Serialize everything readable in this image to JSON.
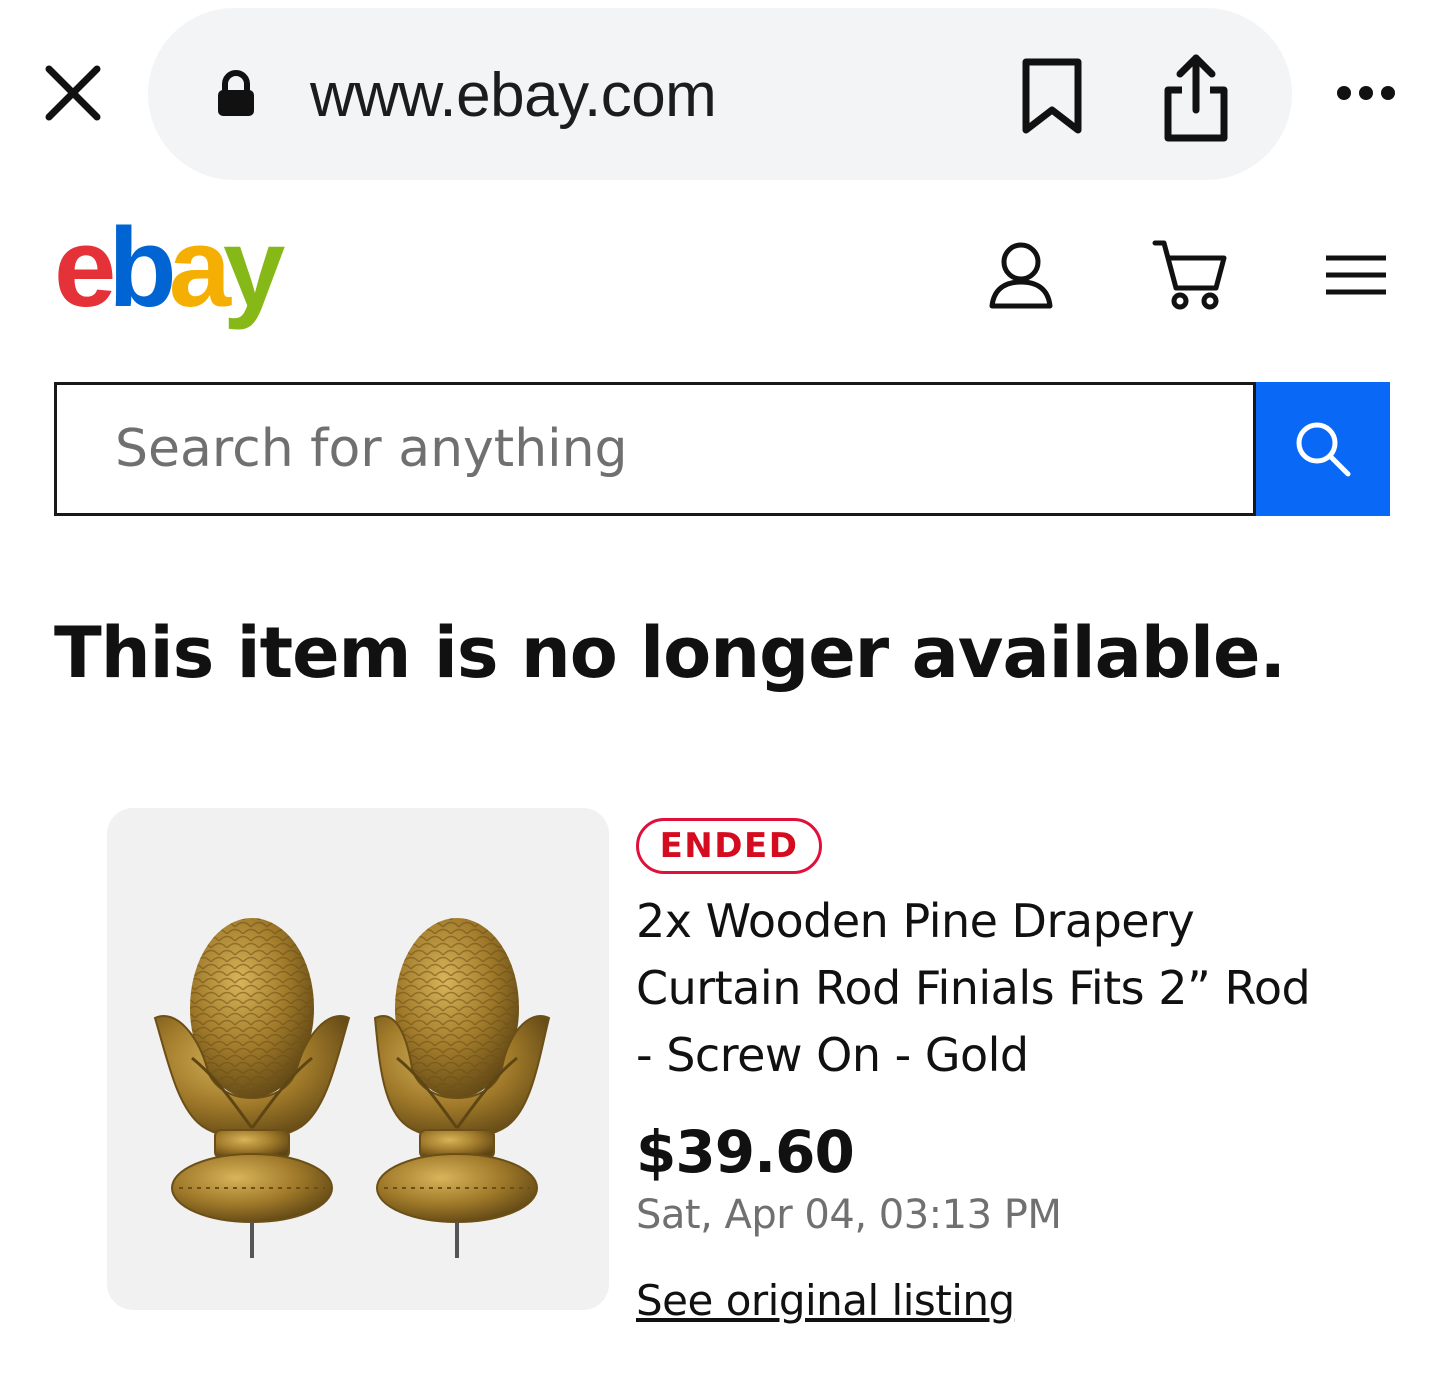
{
  "browser": {
    "url": "www.ebay.com",
    "icons": [
      "close-icon",
      "lock-icon",
      "bookmark-icon",
      "share-icon",
      "more-icon"
    ]
  },
  "header": {
    "logo_letters": [
      "e",
      "b",
      "a",
      "y"
    ],
    "logo_colors": [
      "#e53238",
      "#0064d2",
      "#f5af02",
      "#86b817"
    ],
    "icons": [
      "user-icon",
      "cart-icon",
      "menu-icon"
    ]
  },
  "search": {
    "placeholder": "Search for anything",
    "value": "",
    "button_color": "#0968f6"
  },
  "main": {
    "headline": "This item is no longer available."
  },
  "item": {
    "status_badge": "ENDED",
    "status_color": "#d50b1f",
    "title": "2x Wooden Pine Drapery Curtain Rod Finials Fits 2” Rod - Screw On - Gold",
    "price": "$39.60",
    "date": "Sat, Apr 04, 03:13 PM",
    "link_label": "See original listing"
  }
}
